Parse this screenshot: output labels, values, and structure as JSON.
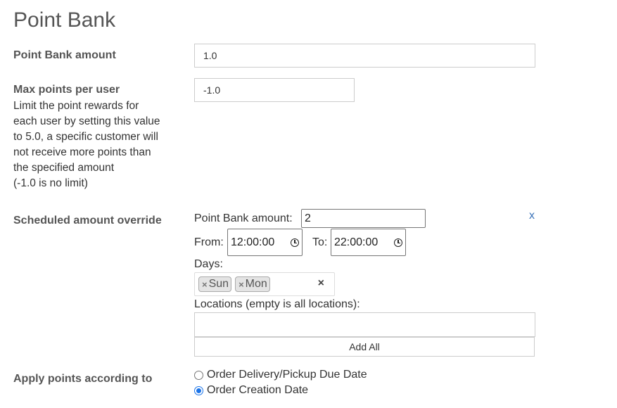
{
  "page_title": "Point Bank",
  "point_bank_amount": {
    "label": "Point Bank amount",
    "value": "1.0"
  },
  "max_points": {
    "label": "Max points per user",
    "help_lines": [
      "Limit the point rewards for",
      "each user by setting this value",
      "to 5.0, a specific customer will",
      "not receive more points than",
      "the specified amount",
      "(-1.0 is no limit)"
    ],
    "value": "-1.0"
  },
  "scheduled_override": {
    "label": "Scheduled amount override",
    "amount_label": "Point Bank amount:",
    "amount_value": "2",
    "remove_label": "x",
    "from_label": "From:",
    "from_value": "12:00:00",
    "to_label": "To:",
    "to_value": "22:00:00",
    "days_label": "Days:",
    "days": [
      "Sun",
      "Mon"
    ],
    "tag_remove": "×",
    "days_clear": "×",
    "locations_label": "Locations (empty is all locations):",
    "locations_value": "",
    "add_all_label": "Add All"
  },
  "apply_points": {
    "label": "Apply points according to",
    "options": [
      {
        "label": "Order Delivery/Pickup Due Date",
        "checked": false
      },
      {
        "label": "Order Creation Date",
        "checked": true
      }
    ]
  },
  "colors": {
    "accent": "#1a73e8",
    "link": "#3b73b9",
    "label": "#555555"
  }
}
